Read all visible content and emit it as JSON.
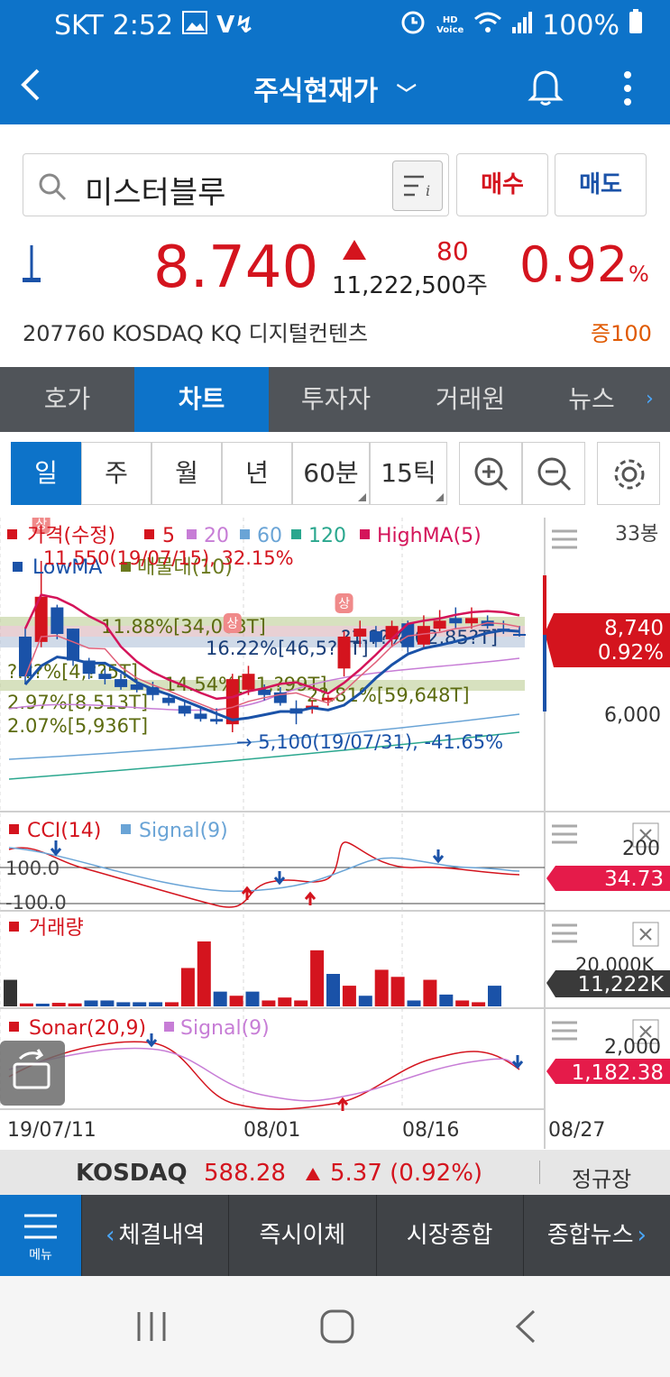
{
  "status_bar": {
    "carrier": "SKT",
    "time": "2:52",
    "battery": "100%",
    "hd_voice": "HD\nVoice"
  },
  "app_bar": {
    "title": "주식현재가"
  },
  "search": {
    "query": "미스터블루"
  },
  "actions": {
    "buy": "매수",
    "sell": "매도"
  },
  "quote": {
    "price": "8.740",
    "change": "80",
    "volume": "11,222,500주",
    "rate": "0.92",
    "rate_unit": "%",
    "info": "207760  KOSDAQ  KQ 디지털컨텐츠",
    "margin": "증100"
  },
  "tabs": [
    {
      "label": "호가"
    },
    {
      "label": "차트"
    },
    {
      "label": "투자자"
    },
    {
      "label": "거래원"
    },
    {
      "label": "뉴스"
    }
  ],
  "periods": [
    {
      "label": "일"
    },
    {
      "label": "주"
    },
    {
      "label": "월"
    },
    {
      "label": "년"
    },
    {
      "label": "60분"
    },
    {
      "label": "15틱"
    }
  ],
  "chart_data": {
    "type": "candlestick",
    "x_ticks": [
      "19/07/11",
      "08/01",
      "08/16",
      "08/27"
    ],
    "count_label": "33봉",
    "price_legend": [
      "가격(수정)",
      "5",
      "20",
      "60",
      "120",
      "HighMA(5)",
      "LowMA",
      "매물대(10)"
    ],
    "price_axis": {
      "tick": "6,000",
      "current": "8,740",
      "current_rate": "0.92%"
    },
    "high_annotation": "11,550(19/07/15), 32.15%",
    "low_annotation": "5,100(19/07/31), -41.65%",
    "volume_profile": [
      "11.88%[34,063T]",
      "16.22%[46,5?1T]",
      "?1.??%[62,85?T]",
      "?.??%[4,??5T]",
      "14.54%[41,?99T]",
      "2?.81%[59,648T]",
      "2.97%[8,513T]",
      "2.07%[5,936T]"
    ],
    "candles": [
      {
        "o": 8700,
        "h": 9000,
        "l": 6900,
        "c": 7200
      },
      {
        "o": 8500,
        "h": 11550,
        "l": 8300,
        "c": 10200
      },
      {
        "o": 9800,
        "h": 9900,
        "l": 8600,
        "c": 8800
      },
      {
        "o": 9000,
        "h": 9000,
        "l": 7600,
        "c": 7800
      },
      {
        "o": 7800,
        "h": 7900,
        "l": 7100,
        "c": 7300
      },
      {
        "o": 7300,
        "h": 7500,
        "l": 6900,
        "c": 7100
      },
      {
        "o": 7100,
        "h": 7300,
        "l": 6700,
        "c": 6800
      },
      {
        "o": 6900,
        "h": 7100,
        "l": 6600,
        "c": 6700
      },
      {
        "o": 6800,
        "h": 7000,
        "l": 6300,
        "c": 6500
      },
      {
        "o": 6400,
        "h": 6500,
        "l": 6100,
        "c": 6200
      },
      {
        "o": 6100,
        "h": 6300,
        "l": 5700,
        "c": 5800
      },
      {
        "o": 5800,
        "h": 6000,
        "l": 5500,
        "c": 5600
      },
      {
        "o": 5600,
        "h": 6000,
        "l": 5400,
        "c": 5500
      },
      {
        "o": 5400,
        "h": 7300,
        "l": 5100,
        "c": 7100
      },
      {
        "o": 6700,
        "h": 7600,
        "l": 6500,
        "c": 7300
      },
      {
        "o": 6700,
        "h": 6900,
        "l": 6300,
        "c": 6500
      },
      {
        "o": 6600,
        "h": 6800,
        "l": 6100,
        "c": 6200
      },
      {
        "o": 6000,
        "h": 6300,
        "l": 5400,
        "c": 5800
      },
      {
        "o": 6000,
        "h": 6300,
        "l": 5800,
        "c": 6100
      },
      {
        "o": 6300,
        "h": 6500,
        "l": 6100,
        "c": 6400
      },
      {
        "o": 7500,
        "h": 8900,
        "l": 7200,
        "c": 8700
      },
      {
        "o": 8700,
        "h": 9300,
        "l": 8300,
        "c": 9000
      },
      {
        "o": 8900,
        "h": 9100,
        "l": 8300,
        "c": 8500
      },
      {
        "o": 8600,
        "h": 9300,
        "l": 8300,
        "c": 9100
      },
      {
        "o": 9200,
        "h": 9300,
        "l": 8100,
        "c": 8300
      },
      {
        "o": 8400,
        "h": 9500,
        "l": 8300,
        "c": 9100
      },
      {
        "o": 9000,
        "h": 9700,
        "l": 8900,
        "c": 9300
      },
      {
        "o": 9400,
        "h": 9800,
        "l": 9000,
        "c": 9200
      },
      {
        "o": 9200,
        "h": 9800,
        "l": 9000,
        "c": 9400
      },
      {
        "o": 9300,
        "h": 9500,
        "l": 9000,
        "c": 9100
      },
      {
        "o": 9000,
        "h": 9300,
        "l": 8800,
        "c": 8900
      },
      {
        "o": 8800,
        "h": 9100,
        "l": 8700,
        "c": 8740
      }
    ],
    "cci": {
      "legend": [
        "CCI(14)",
        "Signal(9)"
      ],
      "levels": [
        "100.0",
        "-100.0"
      ],
      "axis_top": "200",
      "value": "34.73"
    },
    "volume": {
      "legend": "거래량",
      "axis_top": "20,000K",
      "value": "11,222K",
      "values": [
        4.5,
        0.5,
        0.4,
        0.6,
        0.5,
        1.0,
        1.0,
        0.7,
        0.7,
        0.7,
        0.7,
        6.5,
        11.0,
        2.5,
        1.8,
        2.5,
        1.0,
        1.5,
        1.0,
        9.5,
        5.5,
        3.5,
        1.8,
        6.2,
        5.0,
        1.0,
        4.5,
        2.0,
        1.0,
        0.7,
        3.5
      ],
      "colors": [
        "b",
        "r",
        "b",
        "r",
        "r",
        "b",
        "b",
        "b",
        "b",
        "b",
        "r",
        "r",
        "r",
        "b",
        "r",
        "b",
        "r",
        "r",
        "r",
        "r",
        "b",
        "r",
        "b",
        "r",
        "r",
        "b",
        "r",
        "b",
        "r",
        "r",
        "b"
      ]
    },
    "sonar": {
      "legend": [
        "Sonar(20,9)",
        "Signal(9)"
      ],
      "axis_top": "2,000",
      "value": "1,182.38"
    }
  },
  "market": {
    "index": "KOSDAQ",
    "value": "588.28",
    "change": "5.37 (0.92%)",
    "session": "정규장"
  },
  "bottom_nav": {
    "menu": "메뉴",
    "items": [
      "체결내역",
      "즉시이체",
      "시장종합",
      "종합뉴스"
    ]
  },
  "colors": {
    "primary": "#0d73c9",
    "up": "#d4141e",
    "down": "#1a52a8"
  }
}
